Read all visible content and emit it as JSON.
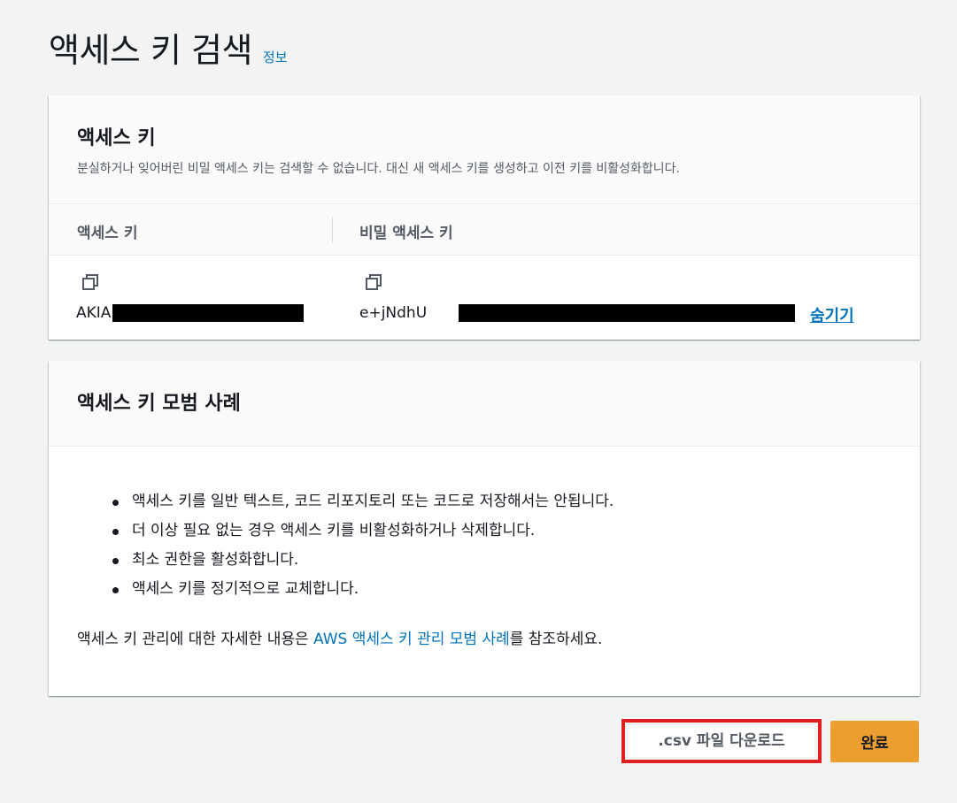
{
  "page": {
    "title": "액세스 키 검색",
    "info_link": "정보"
  },
  "keys_panel": {
    "title": "액세스 키",
    "description": "분실하거나 잊어버린 비밀 액세스 키는 검색할 수 없습니다. 대신 새 액세스 키를 생성하고 이전 키를 비활성화합니다.",
    "columns": [
      "액세스 키",
      "비밀 액세스 키"
    ],
    "access_key_visible": "AKIA",
    "secret_key_visible": "e+jNdhU",
    "copy_icon": "copy-icon",
    "hide_link": "숨기기"
  },
  "practices_panel": {
    "title": "액세스 키 모범 사례",
    "items": [
      "액세스 키를 일반 텍스트, 코드 리포지토리 또는 코드로 저장해서는 안됩니다.",
      "더 이상 필요 없는 경우 액세스 키를 비활성화하거나 삭제합니다.",
      "최소 권한을 활성화합니다.",
      "액세스 키를 정기적으로 교체합니다."
    ],
    "note_prefix": "액세스 키 관리에 대한 자세한 내용은 ",
    "note_link": "AWS 액세스 키 관리 모범 사례",
    "note_suffix": "를 참조하세요."
  },
  "actions": {
    "csv_button": ".csv 파일 다운로드",
    "done_button": "완료"
  },
  "colors": {
    "accent": "#ec9f31",
    "link": "#0073bb",
    "highlight": "#e02020"
  }
}
